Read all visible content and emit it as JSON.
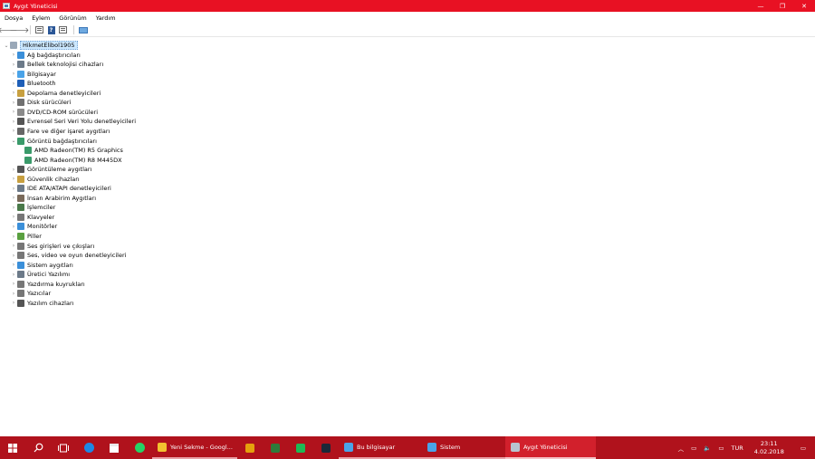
{
  "window": {
    "title": "Aygıt Yöneticisi",
    "controls": {
      "minimize": "—",
      "maximize": "❐",
      "close": "✕"
    }
  },
  "menu": [
    "Dosya",
    "Eylem",
    "Görünüm",
    "Yardım"
  ],
  "toolbar": {
    "back": "🡐",
    "forward": "🡒"
  },
  "tree": {
    "root": "HikmetElibol1905",
    "items": [
      {
        "label": "Ağ bağdaştırıcıları",
        "icon": "network-adapter-icon",
        "color": "#3b8fd9",
        "expanded": false
      },
      {
        "label": "Bellek teknolojisi cihazları",
        "icon": "memory-tech-icon",
        "color": "#6c7a89",
        "expanded": false
      },
      {
        "label": "Bilgisayar",
        "icon": "computer-icon",
        "color": "#4aa3e8",
        "expanded": false
      },
      {
        "label": "Bluetooth",
        "icon": "bluetooth-icon",
        "color": "#1f5fb8",
        "expanded": false
      },
      {
        "label": "Depolama denetleyicileri",
        "icon": "storage-controller-icon",
        "color": "#c8a040",
        "expanded": false
      },
      {
        "label": "Disk sürücüleri",
        "icon": "disk-drive-icon",
        "color": "#707070",
        "expanded": false
      },
      {
        "label": "DVD/CD-ROM sürücüleri",
        "icon": "dvd-drive-icon",
        "color": "#8a8a8a",
        "expanded": false
      },
      {
        "label": "Evrensel Seri Veri Yolu denetleyicileri",
        "icon": "usb-icon",
        "color": "#555555",
        "expanded": false
      },
      {
        "label": "Fare ve diğer işaret aygıtları",
        "icon": "mouse-icon",
        "color": "#666666",
        "expanded": false
      },
      {
        "label": "Görüntü bağdaştırıcıları",
        "icon": "display-adapter-icon",
        "color": "#3a9a6a",
        "expanded": true,
        "children": [
          {
            "label": "AMD Radeon(TM) R5 Graphics",
            "icon": "display-device-icon",
            "color": "#3a9a6a"
          },
          {
            "label": "AMD Radeon(TM) R8 M445DX",
            "icon": "display-device-icon",
            "color": "#3a9a6a"
          }
        ]
      },
      {
        "label": "Görüntüleme aygıtları",
        "icon": "imaging-device-icon",
        "color": "#555555",
        "expanded": false
      },
      {
        "label": "Güvenlik cihazları",
        "icon": "security-device-icon",
        "color": "#c8a040",
        "expanded": false
      },
      {
        "label": "IDE ATA/ATAPI denetleyicileri",
        "icon": "ide-controller-icon",
        "color": "#6c7a89",
        "expanded": false
      },
      {
        "label": "İnsan Arabirim Aygıtları",
        "icon": "hid-icon",
        "color": "#7a6a5a",
        "expanded": false
      },
      {
        "label": "İşlemciler",
        "icon": "processor-icon",
        "color": "#4a7a4a",
        "expanded": false
      },
      {
        "label": "Klavyeler",
        "icon": "keyboard-icon",
        "color": "#777777",
        "expanded": false
      },
      {
        "label": "Monitörler",
        "icon": "monitor-icon",
        "color": "#3b8fd9",
        "expanded": false
      },
      {
        "label": "Piller",
        "icon": "battery-icon",
        "color": "#5aa040",
        "expanded": false
      },
      {
        "label": "Ses girişleri ve çıkışları",
        "icon": "audio-io-icon",
        "color": "#777777",
        "expanded": false
      },
      {
        "label": "Ses, video ve oyun denetleyicileri",
        "icon": "sound-video-icon",
        "color": "#777777",
        "expanded": false
      },
      {
        "label": "Sistem aygıtları",
        "icon": "system-device-icon",
        "color": "#3b8fd9",
        "expanded": false
      },
      {
        "label": "Üretici Yazılımı",
        "icon": "firmware-icon",
        "color": "#6c7a89",
        "expanded": false
      },
      {
        "label": "Yazdırma kuyrukları",
        "icon": "print-queue-icon",
        "color": "#777777",
        "expanded": false
      },
      {
        "label": "Yazıcılar",
        "icon": "printer-icon",
        "color": "#777777",
        "expanded": false
      },
      {
        "label": "Yazılım cihazları",
        "icon": "software-device-icon",
        "color": "#555555",
        "expanded": false
      }
    ]
  },
  "taskbar": {
    "apps": [
      {
        "label": "Yeni Sekme - Googl...",
        "icon": "chrome-icon",
        "color": "#f2c230",
        "state": "open"
      },
      {
        "label": "Bu bilgisayar",
        "icon": "this-pc-icon",
        "color": "#4aa3e8",
        "state": "open"
      },
      {
        "label": "Sistem",
        "icon": "system-icon",
        "color": "#4aa3e8",
        "state": "open"
      },
      {
        "label": "Aygıt Yöneticisi",
        "icon": "device-manager-icon",
        "color": "#b8c4d0",
        "state": "active"
      }
    ],
    "tray": {
      "language": "TUR",
      "time": "23:11",
      "date": "4.02.2018"
    }
  }
}
